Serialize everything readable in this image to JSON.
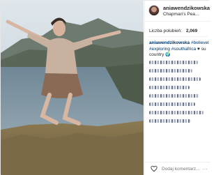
{
  "post": {
    "username": "aniawendzikowska",
    "location": "Chapman's Pea...",
    "likes_label": "Liczba polubień:",
    "likes_count": "2,069",
    "caption": {
      "author": "aniawendzikowska",
      "tag_believe": "#believel",
      "tag_exploring": "#exploring",
      "tag_southafrica": "#southafrica",
      "heart": "♥",
      "word_su": "su",
      "word_country": "country",
      "globe": "🌍"
    },
    "comment_placeholder": "Dodaj komentarz...",
    "more_icon": "…"
  },
  "icons": {
    "avatar": "profile-photo",
    "like": "heart-outline-icon"
  },
  "colors": {
    "link": "#003569",
    "text": "#262626",
    "border": "#efefef"
  }
}
